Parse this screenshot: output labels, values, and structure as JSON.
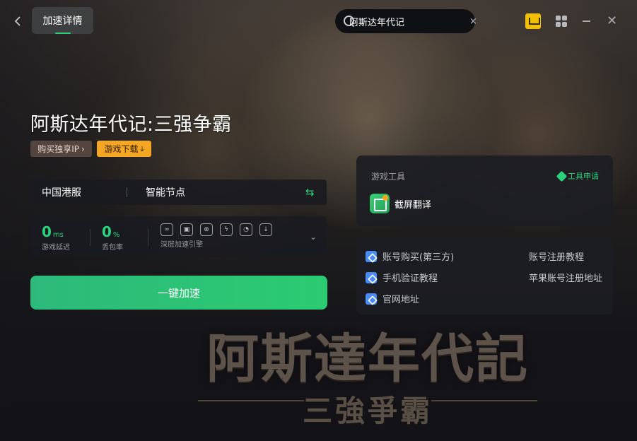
{
  "header": {
    "active_tab": "加速详情",
    "search_value": "阿斯达年代记",
    "clear_symbol": "×"
  },
  "game": {
    "title": "阿斯达年代记:三强争霸",
    "buy_ip_label": "购买独享IP",
    "buy_ip_arrow": "›",
    "download_label": "游戏下载",
    "download_icon": "⤓"
  },
  "server": {
    "region": "中国港服",
    "node": "智能节点",
    "swap_icon": "⇆"
  },
  "stats": {
    "latency_value": "0",
    "latency_unit": "ms",
    "latency_label": "游戏延迟",
    "loss_value": "0",
    "loss_unit": "%",
    "loss_label": "丢包率",
    "engine_label": "深层加速引擎",
    "expand_icon": "⌄"
  },
  "accelerate_label": "一键加速",
  "tools": {
    "title": "游戏工具",
    "apply_label": "工具申请",
    "items": [
      {
        "label": "截屏翻译",
        "icon": "screen-translate-icon"
      }
    ]
  },
  "links": {
    "left": [
      "账号购买(第三方)",
      "手机验证教程",
      "官网地址"
    ],
    "right": [
      "账号注册教程",
      "苹果账号注册地址"
    ]
  },
  "art": {
    "logo_main": "阿斯達年代記",
    "logo_sub": "三強爭霸"
  },
  "colors": {
    "accent_green": "#2bd27d",
    "download_orange": "#f5a623",
    "gift_yellow": "#f2c000",
    "link_blue": "#4a8cf7"
  }
}
